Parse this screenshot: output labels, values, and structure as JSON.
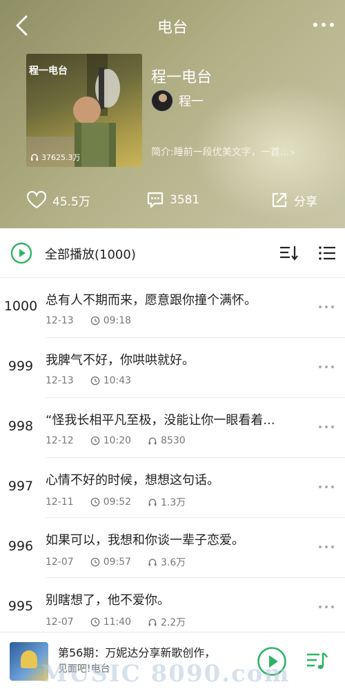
{
  "nav": {
    "title": "电台"
  },
  "album": {
    "cover_title": "程一电台",
    "play_count": "37625.3万",
    "title": "程一电台",
    "author": "程一",
    "intro": "简介:睡前一段优美文字，一首..."
  },
  "actions": {
    "likes": "45.5万",
    "comments": "3581",
    "share": "分享"
  },
  "play_all": {
    "label": "全部播放(1000)"
  },
  "episodes": [
    {
      "num": "1000",
      "title": "总有人不期而来，愿意跟你撞个满怀。",
      "date": "12-13",
      "duration": "09:18",
      "plays": ""
    },
    {
      "num": "999",
      "title": "我脾气不好，你哄哄就好。",
      "date": "12-13",
      "duration": "10:43",
      "plays": ""
    },
    {
      "num": "998",
      "title": "“怪我长相平凡至极，没能让你一眼看着...",
      "date": "12-12",
      "duration": "10:20",
      "plays": "8530"
    },
    {
      "num": "997",
      "title": "心情不好的时候，想想这句话。",
      "date": "12-11",
      "duration": "09:52",
      "plays": "1.3万"
    },
    {
      "num": "996",
      "title": "如果可以，我想和你谈一辈子恋爱。",
      "date": "12-07",
      "duration": "09:57",
      "plays": "3.6万"
    },
    {
      "num": "995",
      "title": "别瞎想了，他不爱你。",
      "date": "12-07",
      "duration": "11:40",
      "plays": "2.2万"
    }
  ],
  "player": {
    "title": "第56期：万妮达分享新歌创作，",
    "subtitle": "见面吧!电台",
    "watermark": "MUSIC 8090.com"
  },
  "colors": {
    "accent": "#2fb463",
    "header_bg": "#a9a87d"
  }
}
